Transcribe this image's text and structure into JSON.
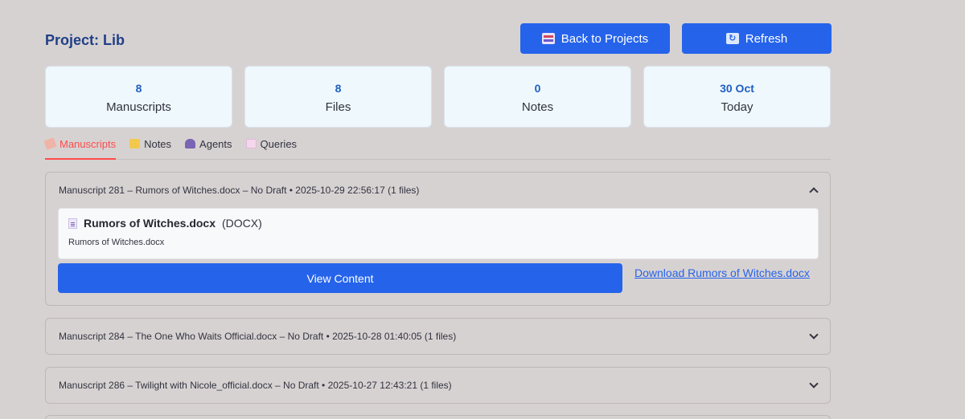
{
  "header": {
    "project_title": "Project: Lib",
    "back_label": "Back to Projects",
    "refresh_label": "Refresh"
  },
  "stats": [
    {
      "value": "8",
      "label": "Manuscripts"
    },
    {
      "value": "8",
      "label": "Files"
    },
    {
      "value": "0",
      "label": "Notes"
    },
    {
      "value": "30 Oct",
      "label": "Today"
    }
  ],
  "tabs": [
    {
      "label": "Manuscripts",
      "icon": "manuscript-icon",
      "active": true
    },
    {
      "label": "Notes",
      "icon": "notes-icon",
      "active": false
    },
    {
      "label": "Agents",
      "icon": "agent-icon",
      "active": false
    },
    {
      "label": "Queries",
      "icon": "envelope-icon",
      "active": false
    }
  ],
  "manuscripts": [
    {
      "header": "Manuscript 281 – Rumors of Witches.docx – No Draft • 2025-10-29 22:56:17 (1 files)",
      "expanded": true,
      "file_name": "Rumors of Witches.docx",
      "file_type": "(DOCX)",
      "file_subtitle": "Rumors of Witches.docx",
      "view_label": "View Content",
      "download_label": "Download Rumors of Witches.docx"
    },
    {
      "header": "Manuscript 284 – The One Who Waits Official.docx – No Draft • 2025-10-28 01:40:05 (1 files)",
      "expanded": false
    },
    {
      "header": "Manuscript 286 – Twilight with Nicole_official.docx – No Draft • 2025-10-27 12:43:21 (1 files)",
      "expanded": false
    }
  ],
  "colors": {
    "background": "#d7d2d2",
    "primary": "#2563eb",
    "title": "#1f3f86",
    "active_tab": "#ff4b4b",
    "card_bg": "#eff8fd"
  }
}
